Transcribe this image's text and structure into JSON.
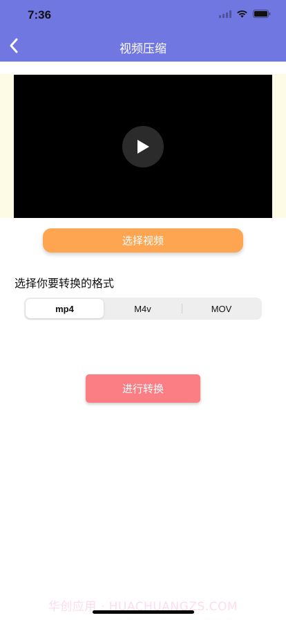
{
  "status_bar": {
    "time": "7:36"
  },
  "nav": {
    "title": "视频压缩",
    "back_icon": "chevron-left-icon"
  },
  "video": {
    "play_icon": "play-icon"
  },
  "actions": {
    "select_video_label": "选择视频",
    "convert_label": "进行转换"
  },
  "format": {
    "label": "选择你要转换的格式",
    "options": [
      "mp4",
      "M4v",
      "MOV"
    ],
    "selected": "mp4"
  },
  "watermark": "华创应用 · HUACHUANGZS.COM",
  "colors": {
    "header": "#7177e0",
    "select_button": "#fda551",
    "convert_button": "#fc7e85",
    "video_band": "#fdfae6"
  }
}
